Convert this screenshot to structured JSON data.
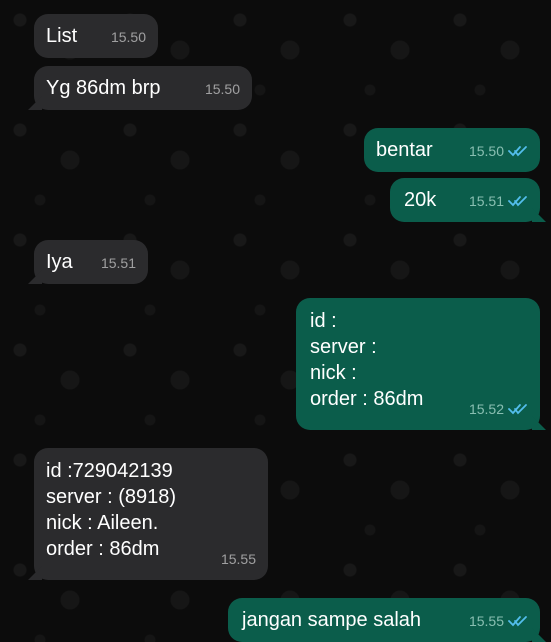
{
  "messages": [
    {
      "text": "List",
      "time": "15.50"
    },
    {
      "text": "Yg 86dm brp",
      "time": "15.50"
    },
    {
      "text": "bentar",
      "time": "15.50"
    },
    {
      "text": "20k",
      "time": "15.51"
    },
    {
      "text": "Iya",
      "time": "15.51"
    },
    {
      "text": "id :\nserver :\nnick :\norder : 86dm",
      "time": "15.52"
    },
    {
      "text": "id :729042139\nserver : (8918)\nnick : Aileen.\norder : 86dm",
      "time": "15.55"
    },
    {
      "text": "jangan sampe salah",
      "time": "15.55"
    }
  ],
  "colors": {
    "incoming_bubble": "#2b2b2d",
    "outgoing_bubble": "#0b5d4b",
    "read_ticks": "#53bdeb"
  },
  "icons": {
    "read_receipt": "double-check-icon"
  }
}
